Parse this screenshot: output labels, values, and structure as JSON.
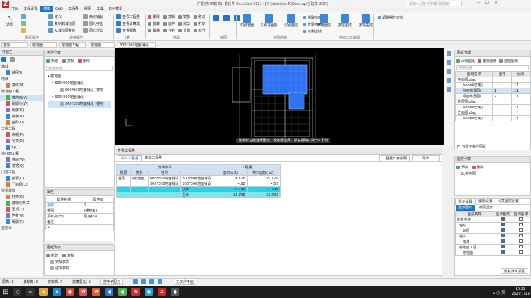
{
  "window": {
    "title": "广联达BIM装饰计量软件 DecoCost 2021 - [C:\\Users\\lsc-R\\Desktop\\自建楼.GDQ]",
    "search_placeholder": "请输入功能名称或问题描述",
    "menu": [
      "开始",
      "工程设置",
      "建模",
      "CAD",
      "工程量",
      "视图",
      "工具",
      "BIM模型"
    ],
    "active_menu": "建模"
  },
  "ribbon": {
    "select_label": "选择",
    "drawing_group": "图纸操作",
    "general_group": "通用操作",
    "calc_group": "计算",
    "modify_group": "修改",
    "draw_group": "绘图",
    "recognize_group": "识别地面",
    "floor_layer_group": "地面二次编辑",
    "items": [
      "定义",
      "复制到其他层",
      "从其他层复制",
      "两点辅轴",
      "图元存盘",
      "图元过滤",
      "查看工程量",
      "查看计算式",
      "查看报表",
      "删除",
      "复制",
      "镜像",
      "移动",
      "旋转",
      "延伸",
      "修剪",
      "打断",
      "偏移",
      "合并",
      "分割",
      "对齐",
      "识别地面",
      "识别块图层",
      "识别面层",
      "提取地面",
      "校验地面",
      "识别虚线",
      "布置面层",
      "按层生成",
      "按块生成",
      "调整摆放方向"
    ]
  },
  "selectors": {
    "floor": "首层",
    "category": "楼地面",
    "type": "楼地面工程",
    "subtype": "楼地面",
    "component": "300*300地面铺设"
  },
  "nav": {
    "title": "导航栏",
    "groups": [
      {
        "name": "轴线",
        "items": [
          "轴网(J)"
        ]
      },
      {
        "name": "墙体",
        "items": [
          "墙体(M)"
        ]
      },
      {
        "name": "楼地面工程",
        "items": [
          "楼地面(Y)",
          "踢脚线(W)",
          "踢脚(K)",
          "楼梯(B)",
          "台阶(D)"
        ]
      },
      {
        "name": "天棚工程",
        "items": [
          "天棚(P)",
          "吊顶(D)",
          "灯(L)"
        ]
      },
      {
        "name": "墙柱面工程",
        "items": [
          "墙面(W)",
          "墙裙(Q)"
        ]
      },
      {
        "name": "门窗工程",
        "items": [
          "窗洞(C)",
          "门窗洞(D)"
        ]
      },
      {
        "name": "零星装饰",
        "items": [
          "灯带(D)",
          "装饰线条(Z)",
          "压顶(Y)",
          "栏杆(G)",
          "踢脚(P)"
        ]
      },
      {
        "name": "自定义",
        "items": []
      }
    ],
    "active_item": "楼地面(Y)"
  },
  "component_list": {
    "title": "构件列表",
    "toolbar": [
      "新建",
      "复制",
      "删除"
    ],
    "search_placeholder": "搜索构件...",
    "tree": [
      "楼地面",
      "800*800地面铺设",
      "800*800地面铺设 [楼地]",
      "300*300地面铺设",
      "300*300地面铺设 [楼地]"
    ],
    "selected": "300*300地面铺设 [楼地]"
  },
  "properties": {
    "title": "属性",
    "headers": [
      "属性名称",
      "属性值"
    ],
    "rows": [
      [
        "名称",
        "1"
      ],
      [
        "类别",
        "(楼地面)"
      ],
      [
        "顶标高(m)",
        "层底标高"
      ],
      [
        "备注",
        ""
      ],
      [
        "+",
        ""
      ]
    ]
  },
  "library": {
    "title": "图纸列表",
    "toolbar": [
      "新建",
      "复制"
    ],
    "items": [
      "实战表现",
      "虚拟表现"
    ]
  },
  "canvas": {
    "hint": "按鼠标左键选择图元，或按框选择，按右键确认或ESC取消"
  },
  "qty_panel": {
    "title": "查看工程量",
    "tabs": [
      "构件工程量",
      "做法工程量"
    ],
    "active_tab": "构件工程量",
    "actions": [
      "工程量计算说明",
      "导出"
    ],
    "head_group1": "分类条件",
    "head_group2": "工程量",
    "headers": [
      "楼层",
      "类别",
      "名称",
      "",
      "面积(m2)",
      "块料面积(m2)"
    ],
    "rows": [
      [
        "首层",
        "(楼地面)",
        "800*800地面铺设",
        "800*800地面铺设",
        "19.176",
        "19.176"
      ],
      [
        "",
        "",
        "300*300地面铺设",
        "300*300地面铺设",
        "4.62",
        "4.62"
      ],
      [
        "",
        "",
        "",
        "小计",
        "23.796",
        "23.796"
      ],
      [
        "",
        "",
        "",
        "总计",
        "23.796",
        "23.796"
      ]
    ]
  },
  "drawing_manager": {
    "title": "图纸管理",
    "toolbar": [
      "添加图纸",
      "删除图纸",
      "整理图纸"
    ],
    "search_placeholder": "搜索图纸",
    "headers": [
      "图纸名称",
      "图号",
      "比例"
    ],
    "rows": [
      [
        "平面图.dwg",
        "",
        ""
      ],
      [
        "Model(已用)",
        "",
        "1:1"
      ],
      [
        "地面布置图(",
        "1",
        "1:1"
      ],
      [
        "顶面布置图(",
        "2",
        "1:1"
      ],
      [
        "首层图.dwg",
        "",
        ""
      ],
      [
        "Model(已用)",
        "",
        "1:1"
      ],
      [
        "立面图.dwg",
        "",
        ""
      ],
      [
        "Model(已用)",
        "",
        "1:1"
      ]
    ],
    "checkbox": "只显示标注图纸"
  },
  "layers_panel": {
    "title": "图层列表",
    "toolbar": [
      "添加",
      "删除"
    ],
    "item": "3D业务图"
  },
  "display_panel": {
    "tabs": [
      "显示设置",
      "图层设置",
      "公共图层设置"
    ],
    "subtabs": [
      "显示图元",
      "楼层显示"
    ],
    "headers": [
      "图层构件",
      "显示图元",
      "显示名称"
    ],
    "rows": [
      [
        "所有构件",
        true,
        false
      ],
      [
        "轴线",
        true,
        false
      ],
      [
        "轴网",
        true,
        false
      ],
      [
        "墙体",
        true,
        false
      ],
      [
        "墙体",
        true,
        false
      ],
      [
        "楼地面工程",
        true,
        false
      ],
      [
        "楼地面",
        true,
        false
      ]
    ],
    "restore": "恢复默认设置"
  },
  "statusbar": {
    "items": [
      "层高: 3",
      "底标高: 0",
      "底标高: 5",
      "隐藏图元: 5"
    ],
    "snap": "选中子图元",
    "plane": "无工作平面"
  },
  "taskbar": {
    "time": "15:22",
    "date": "2022/7/19"
  },
  "colors": {
    "accent": "#1e76c9",
    "canvas": "#000000",
    "fill": "#2f73f5",
    "row_hl": "#27d1e6"
  }
}
